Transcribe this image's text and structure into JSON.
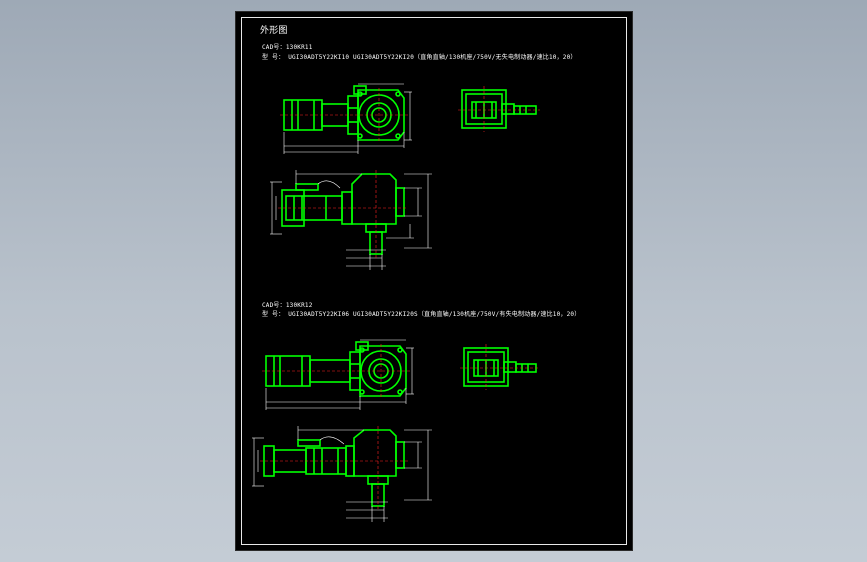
{
  "drawing": {
    "title": "外形图",
    "colors": {
      "background": "#000000",
      "part": "#00ff00",
      "dimension": "#ffffff",
      "centerline": "#ff2020"
    },
    "sections": [
      {
        "cad_label": "CAD号：130KR11",
        "model_label": "型 号： UGI30ADT5Y22KI10  UGI30ADT5Y22KI20（直角直轴/130机座/750V/无失电制动器/速比10，20）"
      },
      {
        "cad_label": "CAD号：130KR12",
        "model_label": "型 号： UGI30ADT5Y22KI06  UGI30ADT5Y22KI20S（直角直轴/130机座/750V/有失电制动器/速比10，20）"
      }
    ]
  }
}
